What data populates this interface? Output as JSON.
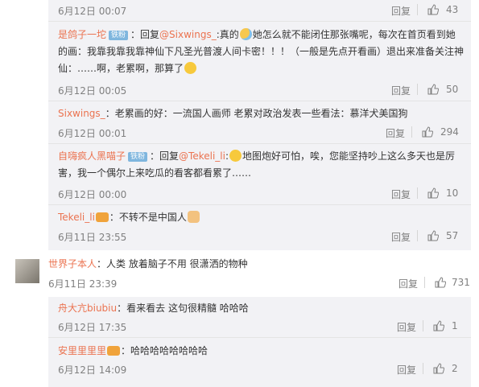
{
  "replies_top": [
    {
      "time": "6月12日 00:07",
      "reply_label": "回复",
      "likes": "43"
    },
    {
      "user": "是鸽子一坨",
      "badge": "铁粉",
      "prefix": "：回复",
      "mention": "@Sixwings_",
      "text1": ":真的",
      "text2": "她怎么就不能闭住那张嘴呢，每次在首页看到她的画：我靠我靠我靠神仙下凡圣光普渡人间卡密！！！（一般是先点开看画）退出来准备关注神仙：……啊，老累啊，那算了",
      "time": "6月12日 00:05",
      "reply_label": "回复",
      "likes": "50"
    },
    {
      "user": "Sixwings_",
      "text": "：老累画的好：一流国人画师 老累对政治发表一些看法：慕洋犬美国狗",
      "time": "6月12日 00:01",
      "reply_label": "回复",
      "likes": "294"
    },
    {
      "user": "自嗨疯人黑喵子",
      "badge": "铁粉",
      "prefix": "：回复",
      "mention": "@Tekeli_li",
      "text1": ":",
      "text2": "地图炮好可怕，唉，您能坚持吵上这么多天也是厉害，我一个偶尔上来吃瓜的看客都看累了……",
      "time": "6月12日 00:00",
      "reply_label": "回复",
      "likes": "10"
    },
    {
      "user": "Tekeli_li",
      "text": "：不转不是中国人",
      "time": "6月11日 23:55",
      "reply_label": "回复",
      "likes": "57"
    }
  ],
  "main_comment": {
    "user": "世界子本人",
    "text": "：人类 放着脑子不用 很潇洒的物种",
    "time": "6月11日 23:39",
    "reply_label": "回复",
    "likes": "731"
  },
  "replies_bottom": [
    {
      "user": "舟大亢biubiu",
      "text": "：看来看去 这句很精髓 哈哈哈",
      "time": "6月12日 17:35",
      "reply_label": "回复",
      "likes": "1"
    },
    {
      "user": "安里里里里",
      "text": "：哈哈哈哈哈哈哈哈",
      "time": "6月12日 14:09",
      "reply_label": "回复",
      "likes": "2"
    }
  ],
  "icons": {
    "like": "thumbs-up-icon",
    "emoji": "emoji-icon",
    "vip": "vip-icon",
    "avatar": "avatar-image"
  },
  "colors": {
    "username": "#eb7350",
    "panel": "#f2f2f5",
    "badge": "#7fb6de"
  }
}
